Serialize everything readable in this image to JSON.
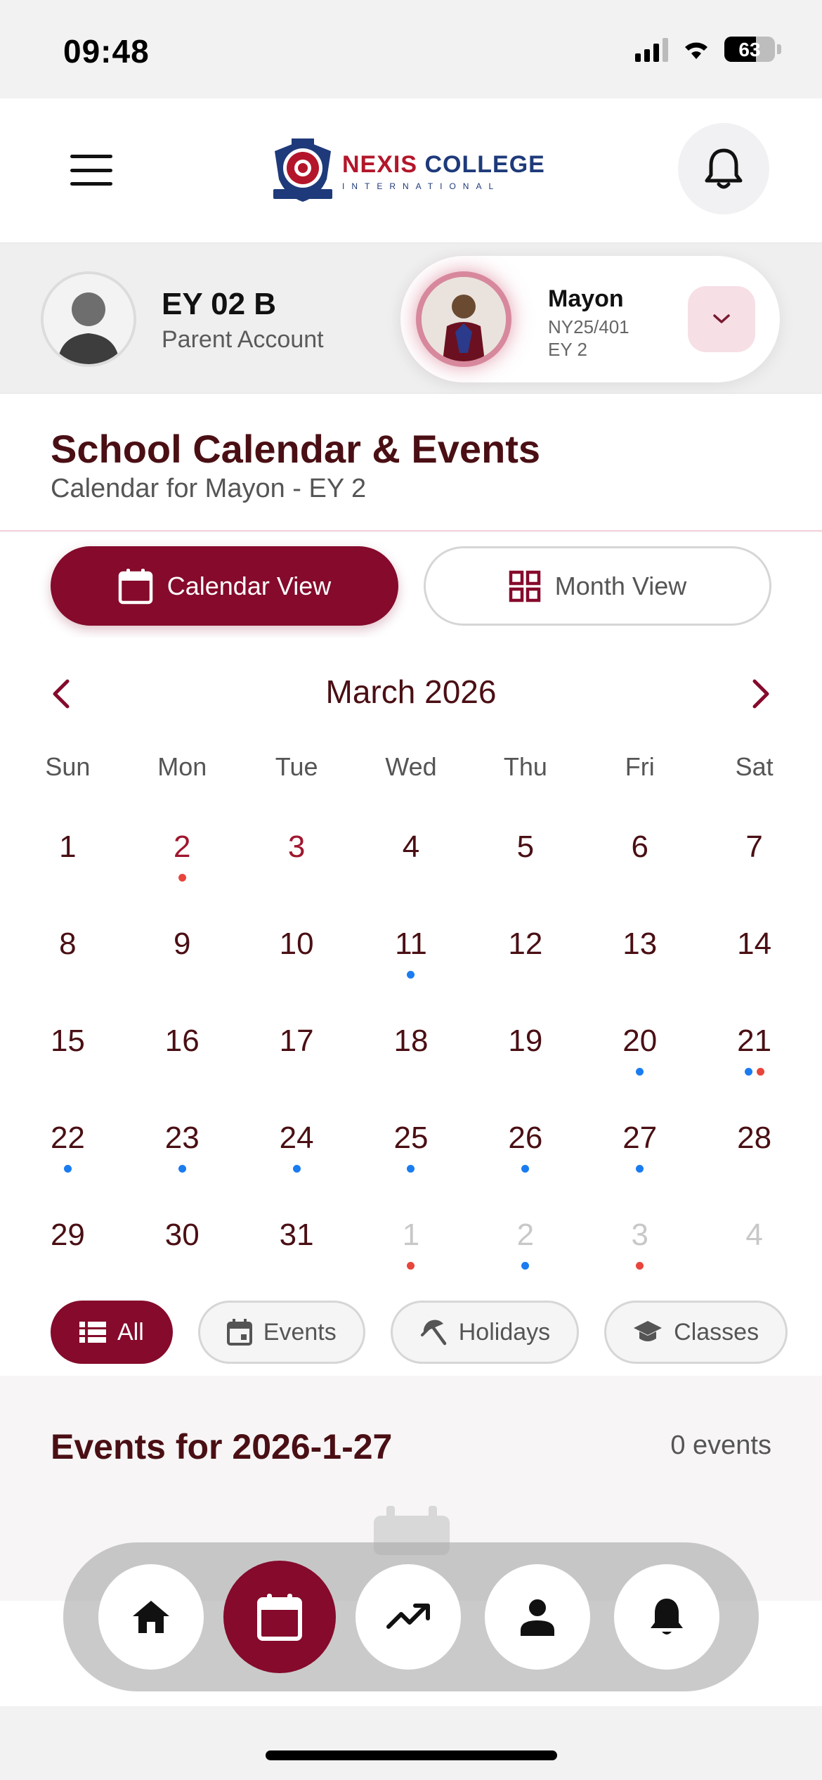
{
  "status_bar": {
    "time": "09:48",
    "battery": "63"
  },
  "header": {
    "logo_name_part1": "NEXIS",
    "logo_name_part2": "COLLEGE",
    "logo_sub": "INTERNATIONAL"
  },
  "parent": {
    "name": "EY 02 B",
    "role": "Parent Account"
  },
  "student": {
    "name": "Mayon",
    "id": "NY25/401",
    "grade": "EY 2"
  },
  "page": {
    "title": "School Calendar & Events",
    "subtitle": "Calendar for Mayon - EY 2"
  },
  "view_tabs": {
    "calendar": "Calendar View",
    "month": "Month View"
  },
  "calendar": {
    "month": "March 2026",
    "weekdays": [
      "Sun",
      "Mon",
      "Tue",
      "Wed",
      "Thu",
      "Fri",
      "Sat"
    ],
    "days": [
      {
        "n": "1"
      },
      {
        "n": "2",
        "tone": "red",
        "dots": [
          "red"
        ]
      },
      {
        "n": "3",
        "tone": "red"
      },
      {
        "n": "4"
      },
      {
        "n": "5"
      },
      {
        "n": "6"
      },
      {
        "n": "7"
      },
      {
        "n": "8"
      },
      {
        "n": "9"
      },
      {
        "n": "10"
      },
      {
        "n": "11",
        "dots": [
          "blue"
        ]
      },
      {
        "n": "12"
      },
      {
        "n": "13"
      },
      {
        "n": "14"
      },
      {
        "n": "15"
      },
      {
        "n": "16"
      },
      {
        "n": "17"
      },
      {
        "n": "18"
      },
      {
        "n": "19"
      },
      {
        "n": "20",
        "dots": [
          "blue"
        ]
      },
      {
        "n": "21",
        "dots": [
          "blue",
          "red"
        ]
      },
      {
        "n": "22",
        "dots": [
          "blue"
        ]
      },
      {
        "n": "23",
        "dots": [
          "blue"
        ]
      },
      {
        "n": "24",
        "dots": [
          "blue"
        ]
      },
      {
        "n": "25",
        "dots": [
          "blue"
        ]
      },
      {
        "n": "26",
        "dots": [
          "blue"
        ]
      },
      {
        "n": "27",
        "dots": [
          "blue"
        ]
      },
      {
        "n": "28"
      },
      {
        "n": "29"
      },
      {
        "n": "30"
      },
      {
        "n": "31"
      },
      {
        "n": "1",
        "other": true,
        "dots": [
          "red"
        ]
      },
      {
        "n": "2",
        "other": true,
        "dots": [
          "blue"
        ]
      },
      {
        "n": "3",
        "other": true,
        "dots": [
          "red"
        ]
      },
      {
        "n": "4",
        "other": true
      }
    ]
  },
  "filters": {
    "all": "All",
    "events": "Events",
    "holidays": "Holidays",
    "classes": "Classes"
  },
  "events": {
    "title": "Events for 2026-1-27",
    "count": "0 events"
  },
  "colors": {
    "accent": "#850a2b",
    "dot_blue": "#1a7cf0",
    "dot_red": "#e8453c"
  },
  "bottom_nav": [
    "home-icon",
    "calendar-icon",
    "trending-up-icon",
    "person-icon",
    "bell-icon"
  ]
}
